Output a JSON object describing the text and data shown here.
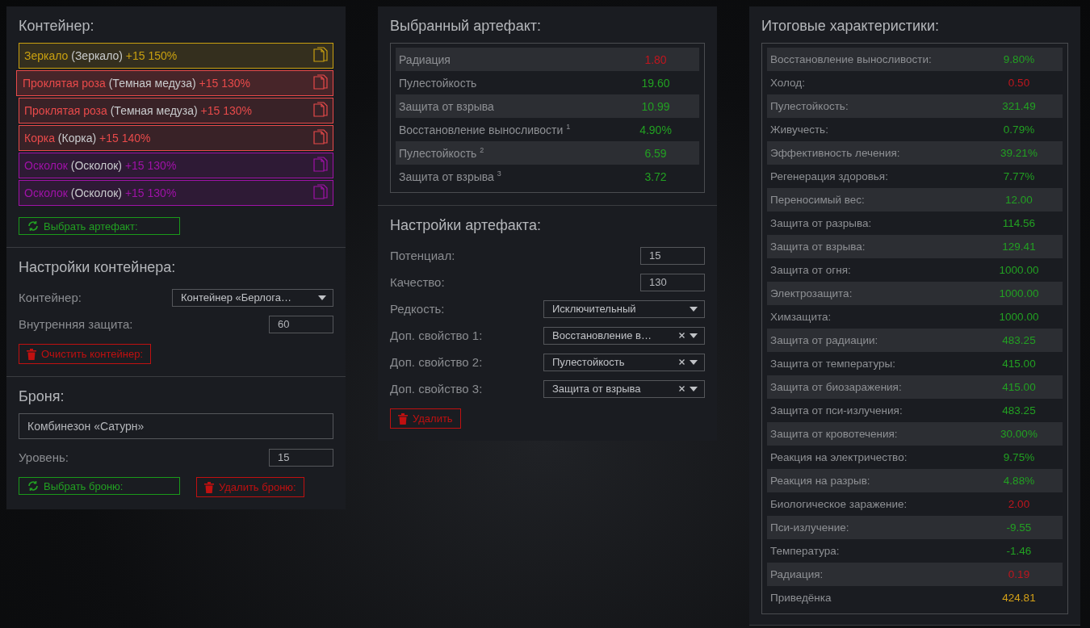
{
  "container_panel": {
    "title": "Контейнер:",
    "slots": [
      {
        "name": "Зеркало",
        "base": "(Зеркало)",
        "bonus": "+15 150%",
        "color": "#c9a010",
        "selected": false
      },
      {
        "name": "Проклятая роза",
        "base": "(Темная медуза)",
        "bonus": "+15 130%",
        "color": "#e84a4a",
        "selected": true
      },
      {
        "name": "Проклятая роза",
        "base": "(Темная медуза)",
        "bonus": "+15 130%",
        "color": "#e84a4a",
        "selected": false
      },
      {
        "name": "Корка",
        "base": "(Корка)",
        "bonus": "+15 140%",
        "color": "#e84a4a",
        "selected": false
      },
      {
        "name": "Осколок",
        "base": "(Осколок)",
        "bonus": "+15 130%",
        "color": "#a012a8",
        "selected": false
      },
      {
        "name": "Осколок",
        "base": "(Осколок)",
        "bonus": "+15 130%",
        "color": "#a012a8",
        "selected": false
      }
    ],
    "button": {
      "kind": "select",
      "label": "Выбрать артефакт:"
    }
  },
  "container_settings": {
    "title": "Настройки контейнера:",
    "fields": [
      {
        "kind": "select",
        "label": "Контейнер:",
        "value": "Контейнер «Берлога…",
        "clearable": false
      },
      {
        "kind": "input",
        "label": "Внутренняя защита:",
        "value": "60"
      }
    ],
    "button": {
      "kind": "delete",
      "label": "Очистить контейнер:"
    }
  },
  "armor": {
    "title": "Броня:",
    "name_value": "Комбинезон «Сатурн»",
    "fields": [
      {
        "kind": "input",
        "label": "Уровень:",
        "value": "15"
      }
    ],
    "buttons": [
      {
        "kind": "select",
        "label": "Выбрать броню:"
      },
      {
        "kind": "delete",
        "label": "Удалить броню:"
      }
    ]
  },
  "selected_artifact": {
    "title": "Выбранный артефакт:",
    "stats": [
      {
        "label": "Радиация",
        "value": "1.80",
        "color": "#c0161e"
      },
      {
        "label": "Пулестойкость",
        "value": "19.60",
        "color": "#22a022"
      },
      {
        "label": "Защита от взрыва",
        "value": "10.99",
        "color": "#22a022"
      },
      {
        "label": "Восстановление выносливости $^{1}$",
        "value": "4.90%",
        "color": "#22a022"
      },
      {
        "label": "Пулестойкость $^{2}$",
        "value": "6.59",
        "color": "#22a022"
      },
      {
        "label": "Защита от взрыва $^{3}$",
        "value": "3.72",
        "color": "#22a022"
      }
    ]
  },
  "artifact_settings": {
    "title": "Настройки артефакта:",
    "fields": [
      {
        "kind": "input",
        "label": "Потенциал:",
        "value": "15"
      },
      {
        "kind": "input",
        "label": "Качество:",
        "value": "130"
      },
      {
        "kind": "select",
        "label": "Редкость:",
        "value": "Исключительный",
        "clearable": false
      },
      {
        "kind": "select",
        "label": "Доп. свойство 1:",
        "value": "Восстановление в…",
        "clearable": true
      },
      {
        "kind": "select",
        "label": "Доп. свойство 2:",
        "value": "Пулестойкость",
        "clearable": true
      },
      {
        "kind": "select",
        "label": "Доп. свойство 3:",
        "value": "Защита от взрыва",
        "clearable": true
      }
    ],
    "button": {
      "kind": "delete",
      "label": "Удалить"
    }
  },
  "totals": {
    "title": "Итоговые характеристики:",
    "stats": [
      {
        "label": "Восстановление выносливости:",
        "value": "9.80%",
        "color": "#22a022"
      },
      {
        "label": "Холод:",
        "value": "0.50",
        "color": "#c0161e"
      },
      {
        "label": "Пулестойкость:",
        "value": "321.49",
        "color": "#22a022"
      },
      {
        "label": "Живучесть:",
        "value": "0.79%",
        "color": "#22a022"
      },
      {
        "label": "Эффективность лечения:",
        "value": "39.21%",
        "color": "#22a022"
      },
      {
        "label": "Регенерация здоровья:",
        "value": "7.77%",
        "color": "#22a022"
      },
      {
        "label": "Переносимый вес:",
        "value": "12.00",
        "color": "#22a022"
      },
      {
        "label": "Защита от разрыва:",
        "value": "114.56",
        "color": "#22a022"
      },
      {
        "label": "Защита от взрыва:",
        "value": "129.41",
        "color": "#22a022"
      },
      {
        "label": "Защита от огня:",
        "value": "1000.00",
        "color": "#22a022"
      },
      {
        "label": "Электрозащита:",
        "value": "1000.00",
        "color": "#22a022"
      },
      {
        "label": "Химзащита:",
        "value": "1000.00",
        "color": "#22a022"
      },
      {
        "label": "Защита от радиации:",
        "value": "483.25",
        "color": "#22a022"
      },
      {
        "label": "Защита от температуры:",
        "value": "415.00",
        "color": "#22a022"
      },
      {
        "label": "Защита от биозаражения:",
        "value": "415.00",
        "color": "#22a022"
      },
      {
        "label": "Защита от пси-излучения:",
        "value": "483.25",
        "color": "#22a022"
      },
      {
        "label": "Защита от кровотечения:",
        "value": "30.00%",
        "color": "#22a022"
      },
      {
        "label": "Реакция на электричество:",
        "value": "9.75%",
        "color": "#22a022"
      },
      {
        "label": "Реакция на разрыв:",
        "value": "4.88%",
        "color": "#22a022"
      },
      {
        "label": "Биологическое заражение:",
        "value": "2.00",
        "color": "#c0161e"
      },
      {
        "label": "Пси-излучение:",
        "value": "-9.55",
        "color": "#22a022"
      },
      {
        "label": "Температура:",
        "value": "-1.46",
        "color": "#22a022"
      },
      {
        "label": "Радиация:",
        "value": "0.19",
        "color": "#c0161e"
      },
      {
        "label": "Приведёнка",
        "value": "424.81",
        "color": "#d4a017"
      }
    ]
  }
}
